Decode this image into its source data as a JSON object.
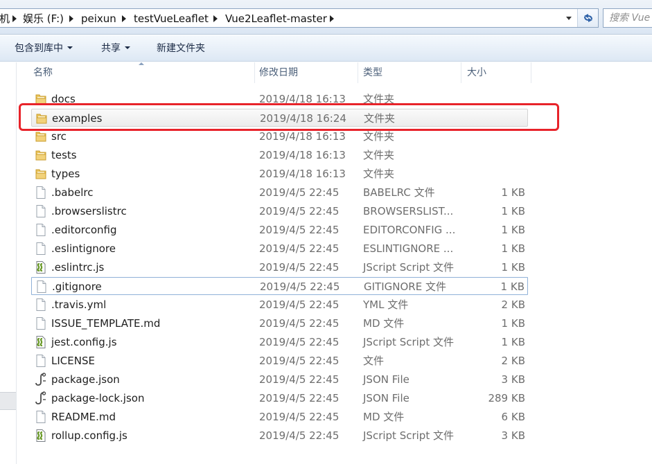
{
  "address": {
    "crumbs": [
      "机",
      "娱乐 (F:)",
      "peixun",
      "testVueLeaflet",
      "Vue2Leaflet-master"
    ]
  },
  "search": {
    "placeholder": "搜索 Vue"
  },
  "toolbar": {
    "include_in_library": "包含到库中",
    "share": "共享",
    "new_folder": "新建文件夹"
  },
  "columns": {
    "name": "名称",
    "date": "修改日期",
    "type": "类型",
    "size": "大小"
  },
  "files": [
    {
      "name": "docs",
      "date": "2019/4/18 16:13",
      "type": "文件夹",
      "size": "",
      "icon": "folder-icon"
    },
    {
      "name": "examples",
      "date": "2019/4/18 16:24",
      "type": "文件夹",
      "size": "",
      "icon": "folder-icon"
    },
    {
      "name": "src",
      "date": "2019/4/18 16:13",
      "type": "文件夹",
      "size": "",
      "icon": "folder-icon"
    },
    {
      "name": "tests",
      "date": "2019/4/18 16:13",
      "type": "文件夹",
      "size": "",
      "icon": "folder-icon"
    },
    {
      "name": "types",
      "date": "2019/4/18 16:13",
      "type": "文件夹",
      "size": "",
      "icon": "folder-icon"
    },
    {
      "name": ".babelrc",
      "date": "2019/4/5 22:45",
      "type": "BABELRC 文件",
      "size": "1 KB",
      "icon": "file-icon"
    },
    {
      "name": ".browserslistrc",
      "date": "2019/4/5 22:45",
      "type": "BROWSERSLIST...",
      "size": "1 KB",
      "icon": "file-icon"
    },
    {
      "name": ".editorconfig",
      "date": "2019/4/5 22:45",
      "type": "EDITORCONFIG ...",
      "size": "1 KB",
      "icon": "file-icon"
    },
    {
      "name": ".eslintignore",
      "date": "2019/4/5 22:45",
      "type": "ESLINTIGNORE ...",
      "size": "1 KB",
      "icon": "file-icon"
    },
    {
      "name": ".eslintrc.js",
      "date": "2019/4/5 22:45",
      "type": "JScript Script 文件",
      "size": "1 KB",
      "icon": "script-icon"
    },
    {
      "name": ".gitignore",
      "date": "2019/4/5 22:45",
      "type": "GITIGNORE 文件",
      "size": "1 KB",
      "icon": "file-icon"
    },
    {
      "name": ".travis.yml",
      "date": "2019/4/5 22:45",
      "type": "YML 文件",
      "size": "2 KB",
      "icon": "file-icon"
    },
    {
      "name": "ISSUE_TEMPLATE.md",
      "date": "2019/4/5 22:45",
      "type": "MD 文件",
      "size": "1 KB",
      "icon": "file-icon"
    },
    {
      "name": "jest.config.js",
      "date": "2019/4/5 22:45",
      "type": "JScript Script 文件",
      "size": "1 KB",
      "icon": "script-icon"
    },
    {
      "name": "LICENSE",
      "date": "2019/4/5 22:45",
      "type": "文件",
      "size": "2 KB",
      "icon": "file-icon"
    },
    {
      "name": "package.json",
      "date": "2019/4/5 22:45",
      "type": "JSON File",
      "size": "3 KB",
      "icon": "json-icon"
    },
    {
      "name": "package-lock.json",
      "date": "2019/4/5 22:45",
      "type": "JSON File",
      "size": "289 KB",
      "icon": "json-icon"
    },
    {
      "name": "README.md",
      "date": "2019/4/5 22:45",
      "type": "MD 文件",
      "size": "6 KB",
      "icon": "file-icon"
    },
    {
      "name": "rollup.config.js",
      "date": "2019/4/5 22:45",
      "type": "JScript Script 文件",
      "size": "3 KB",
      "icon": "script-icon"
    }
  ],
  "hover_row": "examples",
  "focus_row": ".gitignore",
  "colors": {
    "highlight": "#e8232a",
    "hover": "#ececec",
    "focus_border": "#8fb1d8"
  }
}
